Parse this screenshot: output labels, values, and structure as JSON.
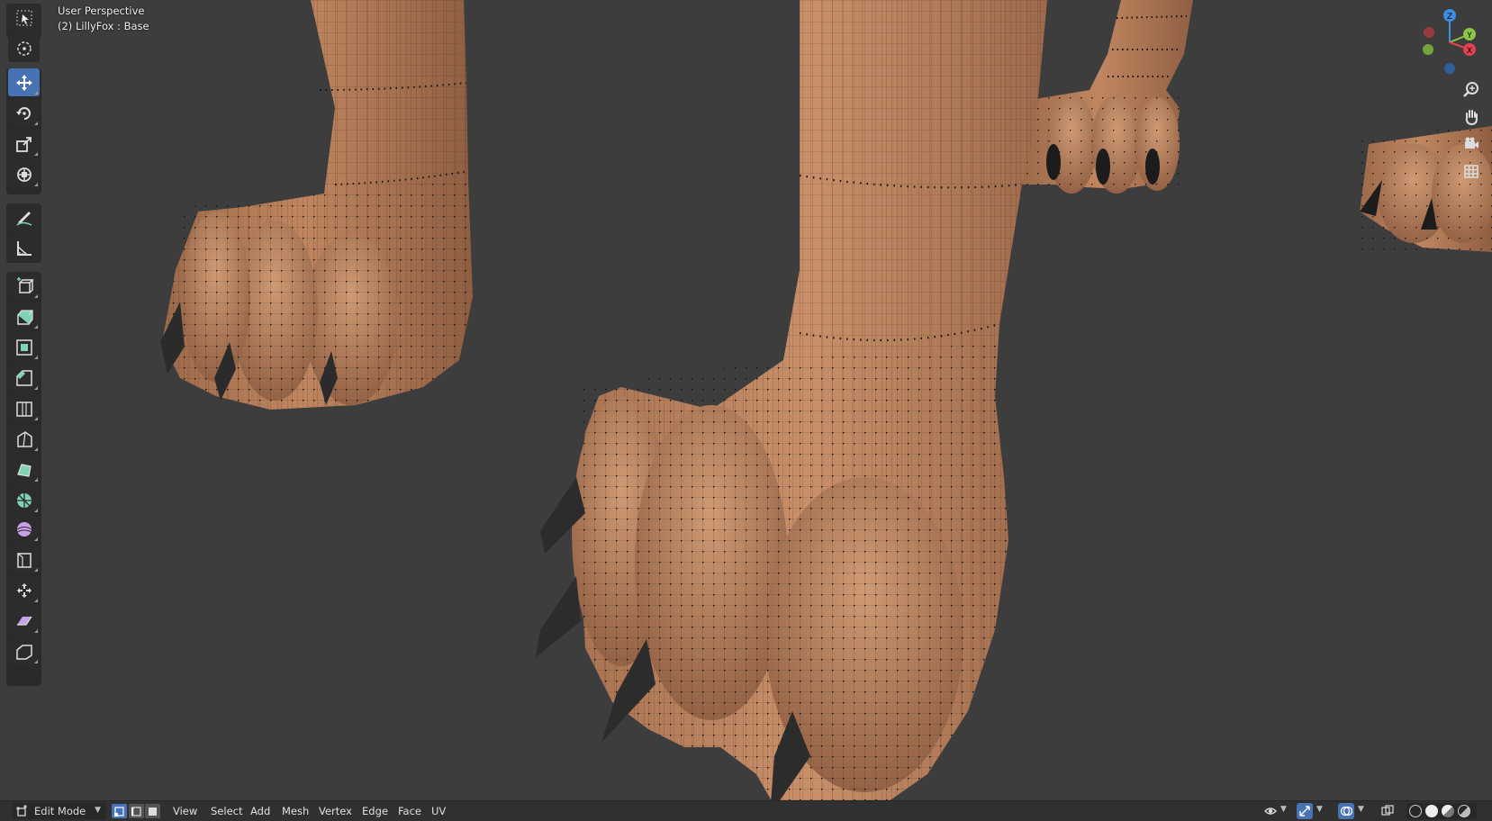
{
  "viewport": {
    "title": "User Perspective",
    "object_info": "(2) LillyFox : Base"
  },
  "toolbar": {
    "tools": [
      {
        "name": "select-box",
        "icon": "select-box-icon",
        "active": false
      },
      {
        "name": "cursor",
        "icon": "cursor-icon",
        "active": false
      },
      {
        "name": "move",
        "icon": "move-icon",
        "active": true
      },
      {
        "name": "rotate",
        "icon": "rotate-icon",
        "active": false
      },
      {
        "name": "scale",
        "icon": "scale-icon",
        "active": false
      },
      {
        "name": "transform",
        "icon": "transform-icon",
        "active": false
      },
      {
        "name": "annotate",
        "icon": "annotate-icon",
        "active": false
      },
      {
        "name": "measure",
        "icon": "measure-icon",
        "active": false
      },
      {
        "name": "add-cube",
        "icon": "add-cube-icon",
        "active": false
      },
      {
        "name": "extrude-region",
        "icon": "extrude-icon",
        "active": false
      },
      {
        "name": "inset-faces",
        "icon": "inset-icon",
        "active": false
      },
      {
        "name": "bevel",
        "icon": "bevel-icon",
        "active": false
      },
      {
        "name": "loop-cut",
        "icon": "loop-cut-icon",
        "active": false
      },
      {
        "name": "knife",
        "icon": "knife-icon",
        "active": false
      },
      {
        "name": "poly-build",
        "icon": "poly-build-icon",
        "active": false
      },
      {
        "name": "spin",
        "icon": "spin-icon",
        "active": false
      },
      {
        "name": "smooth",
        "icon": "smooth-icon",
        "active": false
      },
      {
        "name": "edge-slide",
        "icon": "edge-slide-icon",
        "active": false
      },
      {
        "name": "shrink-fatten",
        "icon": "shrink-fatten-icon",
        "active": false
      },
      {
        "name": "shear",
        "icon": "shear-icon",
        "active": false
      },
      {
        "name": "rip-region",
        "icon": "rip-icon",
        "active": false
      }
    ]
  },
  "gizmo": {
    "axes": [
      "Z",
      "Y",
      "X"
    ],
    "colors": {
      "x": "#e2424b",
      "y": "#8ac544",
      "z": "#3f8ee2"
    }
  },
  "navigation": [
    "zoom-icon",
    "pan-hand-icon",
    "camera-icon",
    "ortho-grid-icon"
  ],
  "header": {
    "mode": "Edit Mode",
    "select_modes": [
      "vertex-select-icon",
      "edge-select-icon",
      "face-select-icon"
    ],
    "menus": [
      "View",
      "Select",
      "Add",
      "Mesh",
      "Vertex",
      "Edge",
      "Face",
      "UV"
    ],
    "right_icons": [
      "visibility-icon",
      "gizmo-icon",
      "overlay-icon",
      "xray-icon"
    ],
    "shading": [
      "wireframe-shading-icon",
      "solid-shading-icon",
      "material-shading-icon",
      "rendered-shading-icon"
    ],
    "accent": "#4772b3"
  }
}
